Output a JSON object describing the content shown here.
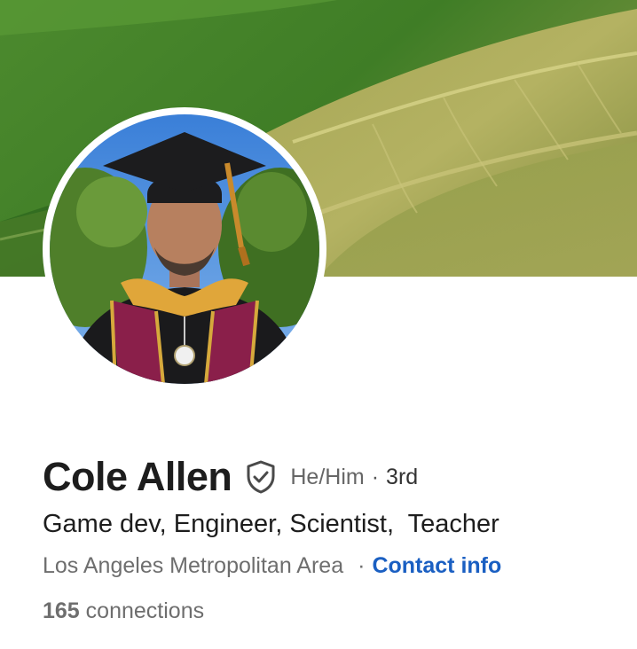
{
  "profile": {
    "name": "Cole Allen",
    "pronouns": "He/Him",
    "separator": "·",
    "degree": "3rd",
    "headline": "Game dev, Engineer, Scientist,  Teacher",
    "location": "Los Angeles Metropolitan Area",
    "location_separator": "·",
    "contact_link": "Contact info",
    "connections_count": "165",
    "connections_label": "connections"
  },
  "icons": {
    "verified": "verified-shield-icon"
  },
  "colors": {
    "link": "#1a5fc2",
    "name_text": "#1d1d1d",
    "secondary_text": "#6e6e6e"
  }
}
